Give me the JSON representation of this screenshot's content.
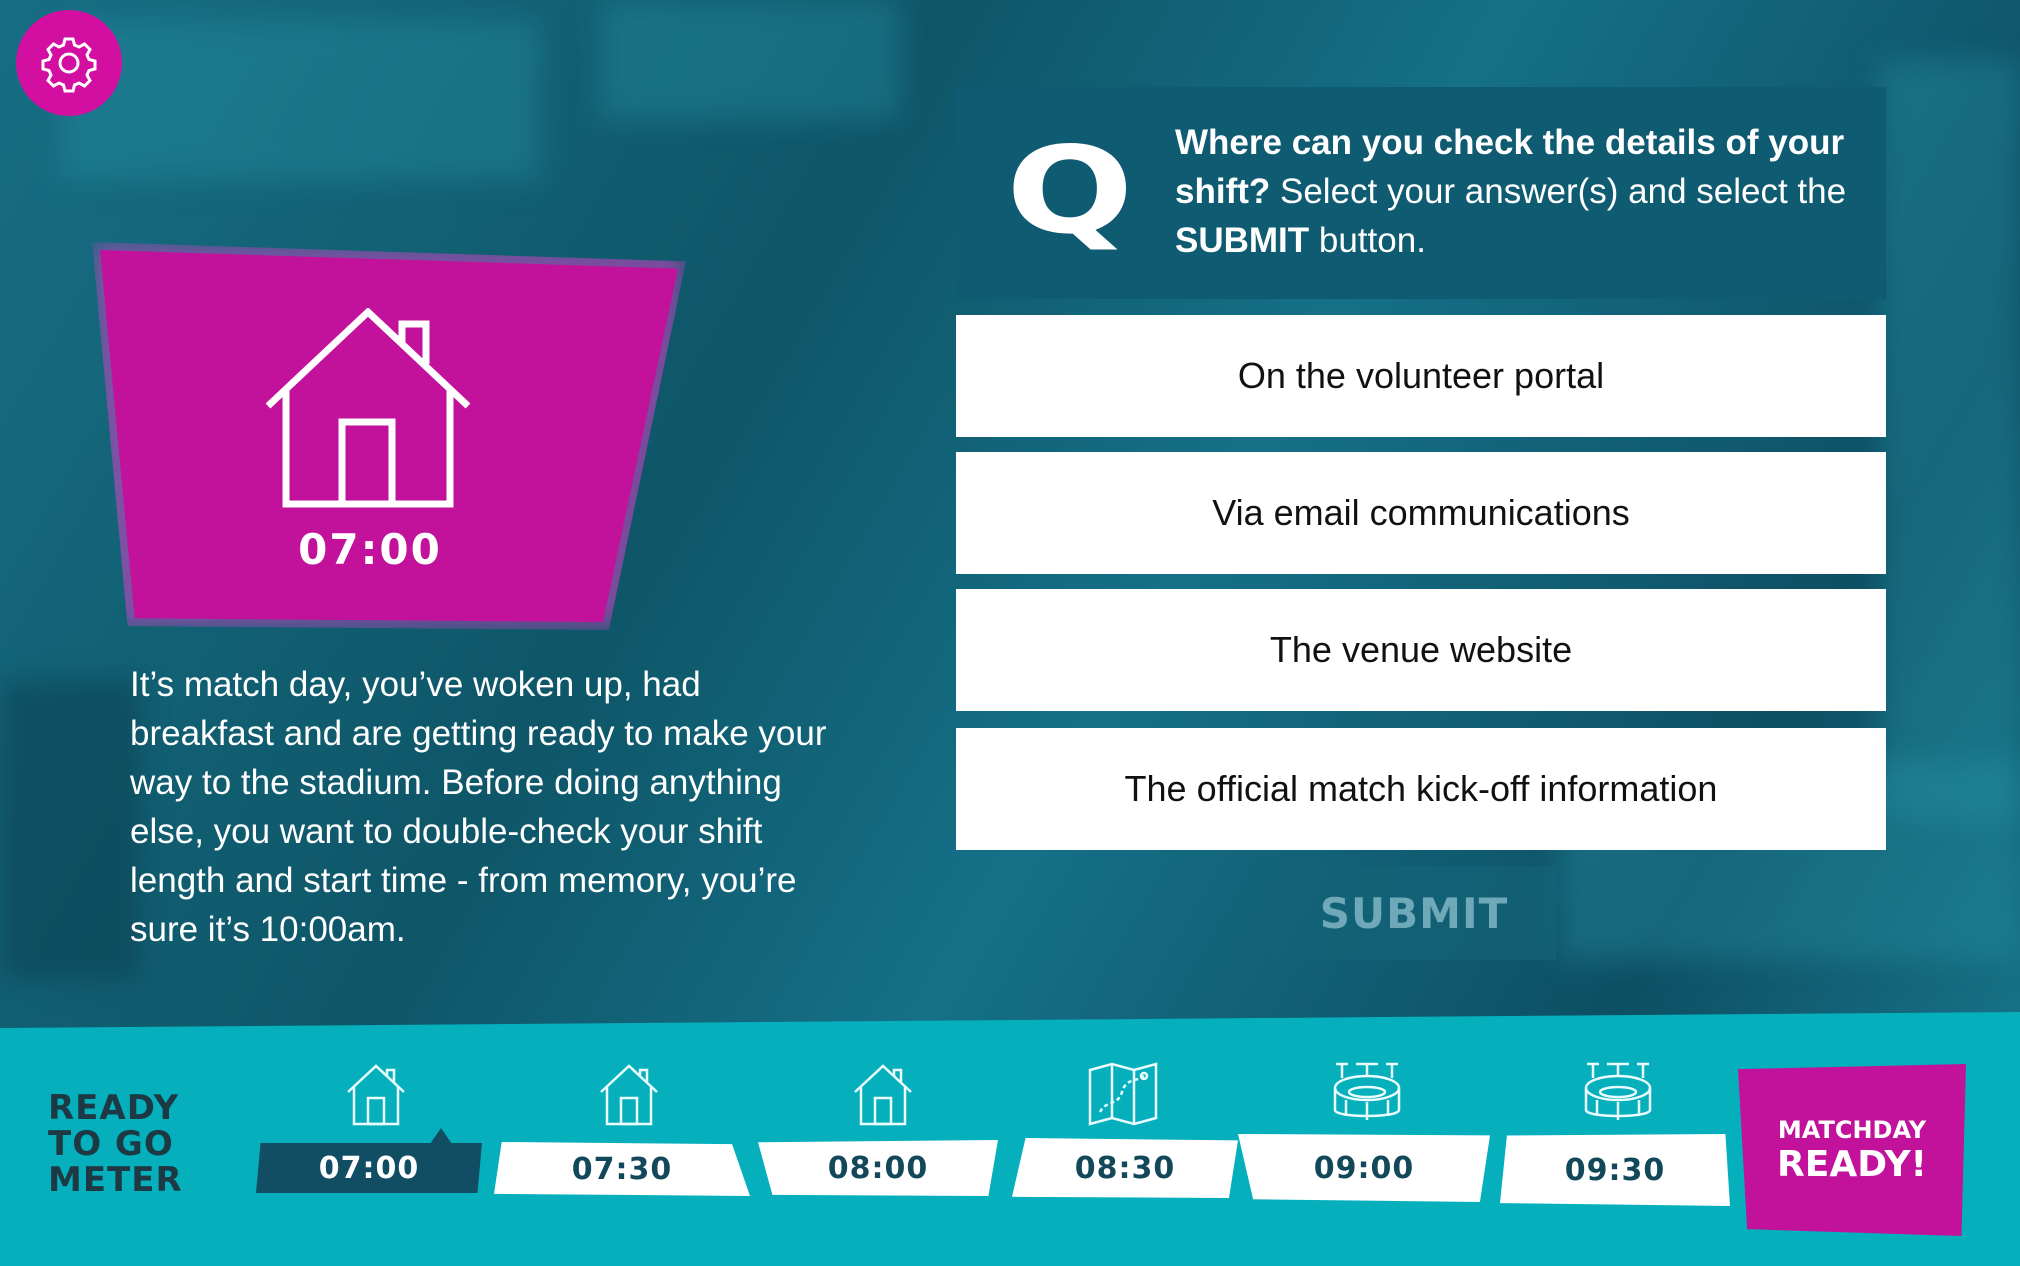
{
  "scene": {
    "time": "07:00",
    "icon": "house-icon",
    "story": "It’s match day, you’ve woken up, had breakfast and are getting ready to make your way to the stadium. Before doing anything else, you want to double-check your shift length and start time - from memory, you’re sure it’s 10:00am."
  },
  "question": {
    "marker": "Q",
    "bold_part": "Where can you check the details of your shift?",
    "instruction_part1": " Select your answer(s) and select the ",
    "submit_word": "SUBMIT",
    "instruction_part2": " button."
  },
  "answers": [
    "On the volunteer portal",
    "Via email communications",
    "The venue website",
    "The official match kick-off information"
  ],
  "submit_label": "SUBMIT",
  "meter": {
    "title_line1": "READY",
    "title_line2": "TO GO",
    "title_line3": "METER",
    "slots": [
      {
        "time": "07:00",
        "icon": "house-icon",
        "active": true
      },
      {
        "time": "07:30",
        "icon": "house-icon",
        "active": false
      },
      {
        "time": "08:00",
        "icon": "house-icon",
        "active": false
      },
      {
        "time": "08:30",
        "icon": "map-icon",
        "active": false
      },
      {
        "time": "09:00",
        "icon": "stadium-icon",
        "active": false
      },
      {
        "time": "09:30",
        "icon": "stadium-icon",
        "active": false
      }
    ],
    "final_line1": "MATCHDAY",
    "final_line2": "READY!"
  },
  "colors": {
    "magenta": "#c2119a",
    "teal_bar": "#05afbc",
    "dark_teal": "#0f5b71"
  }
}
